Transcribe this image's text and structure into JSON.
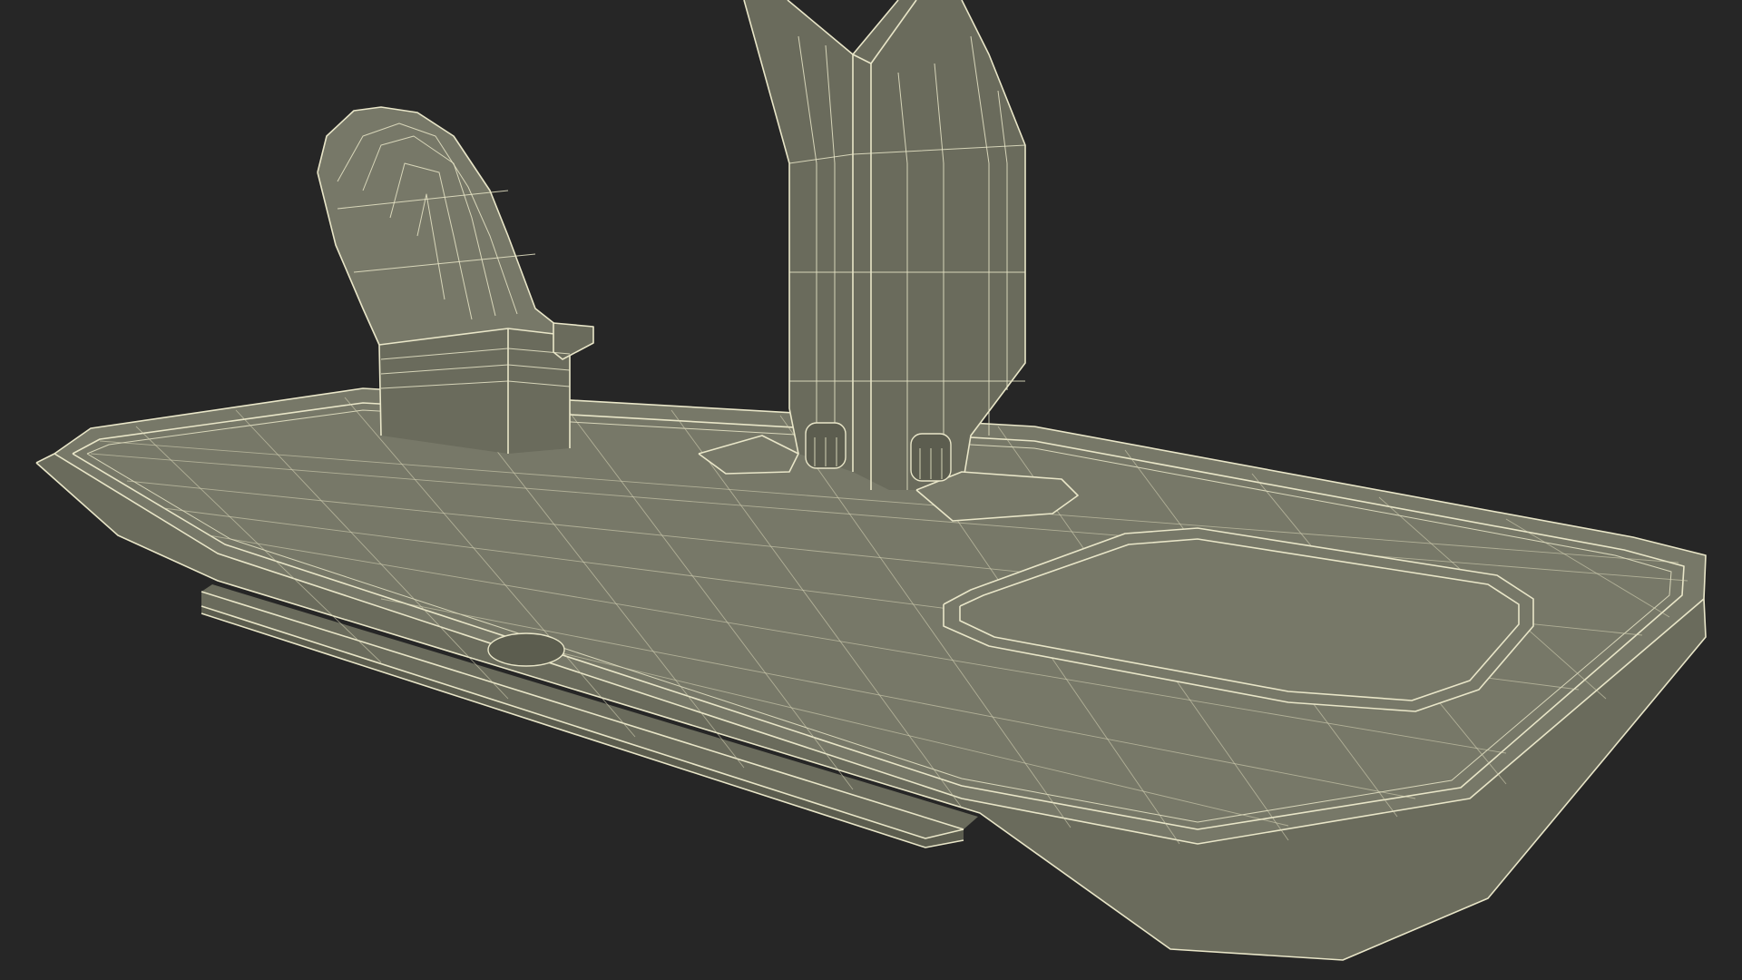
{
  "scene": {
    "subject": "wireframe-3d-render",
    "colors": {
      "background": "#262626",
      "surface": "#777868",
      "surface_dark": "#5c5d4f",
      "surface_side": "#6a6b5c",
      "wire": "#e9e6c8",
      "wire_faint": "#d7d4b6"
    }
  }
}
